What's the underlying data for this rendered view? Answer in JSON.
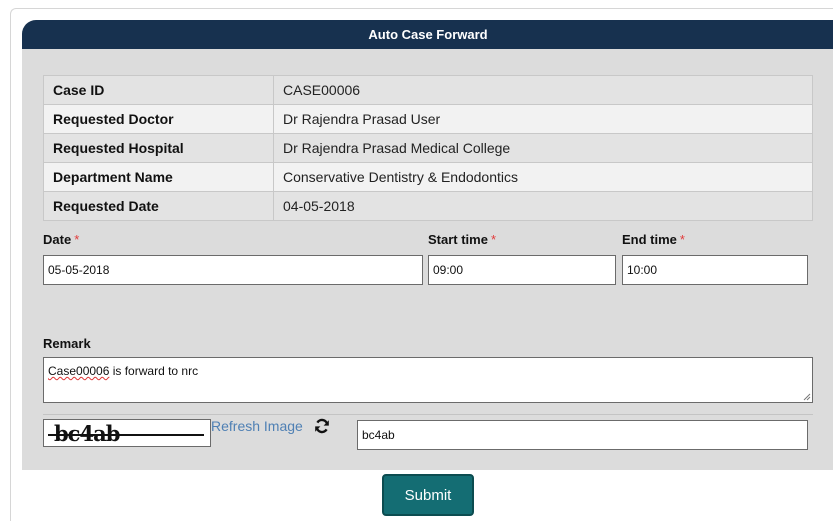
{
  "header": {
    "title": "Auto Case Forward"
  },
  "info": {
    "rows": [
      {
        "label": "Case ID",
        "value": "CASE00006"
      },
      {
        "label": "Requested Doctor",
        "value": "Dr Rajendra Prasad User"
      },
      {
        "label": "Requested Hospital",
        "value": "Dr Rajendra Prasad Medical College"
      },
      {
        "label": "Department Name",
        "value": "Conservative Dentistry & Endodontics"
      },
      {
        "label": "Requested Date",
        "value": "04-05-2018"
      }
    ]
  },
  "form": {
    "date_label": "Date",
    "start_label": "Start time",
    "end_label": "End time",
    "required_mark": "*",
    "date_value": "05-05-2018",
    "start_value": "09:00",
    "end_value": "10:00",
    "remark_label": "Remark",
    "remark_word": "Case00006",
    "remark_rest": " is forward to nrc"
  },
  "captcha": {
    "image_text": "bc4ab",
    "refresh_label": "Refresh Image",
    "refresh_icon": "refresh-icon",
    "input_value": "bc4ab"
  },
  "submit_label": "Submit",
  "colors": {
    "header": "#17314f",
    "submit": "#146d73",
    "link": "#4f80b4",
    "required": "#e23b3b"
  }
}
